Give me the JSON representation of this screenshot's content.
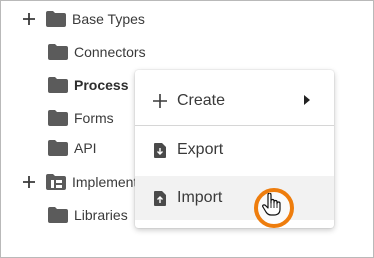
{
  "tree": {
    "items": [
      {
        "label": "Base Types",
        "expander": "+"
      },
      {
        "label": "Connectors"
      },
      {
        "label": "Process"
      },
      {
        "label": "Forms"
      },
      {
        "label": "API"
      },
      {
        "label": "Implementations",
        "expander": "+"
      },
      {
        "label": "Libraries"
      }
    ]
  },
  "context_menu": {
    "create_label": "Create",
    "export_label": "Export",
    "import_label": "Import"
  },
  "colors": {
    "folder": "#5b5b5b",
    "highlight_ring": "#ee7d0d",
    "menu_hover": "#f2f2f2"
  },
  "icons": {
    "expand": "plus-icon",
    "folder": "folder-icon",
    "create": "plus-icon",
    "export": "file-download-icon",
    "import": "file-upload-icon",
    "submenu": "chevron-right-icon",
    "cursor": "hand-pointer-icon"
  }
}
